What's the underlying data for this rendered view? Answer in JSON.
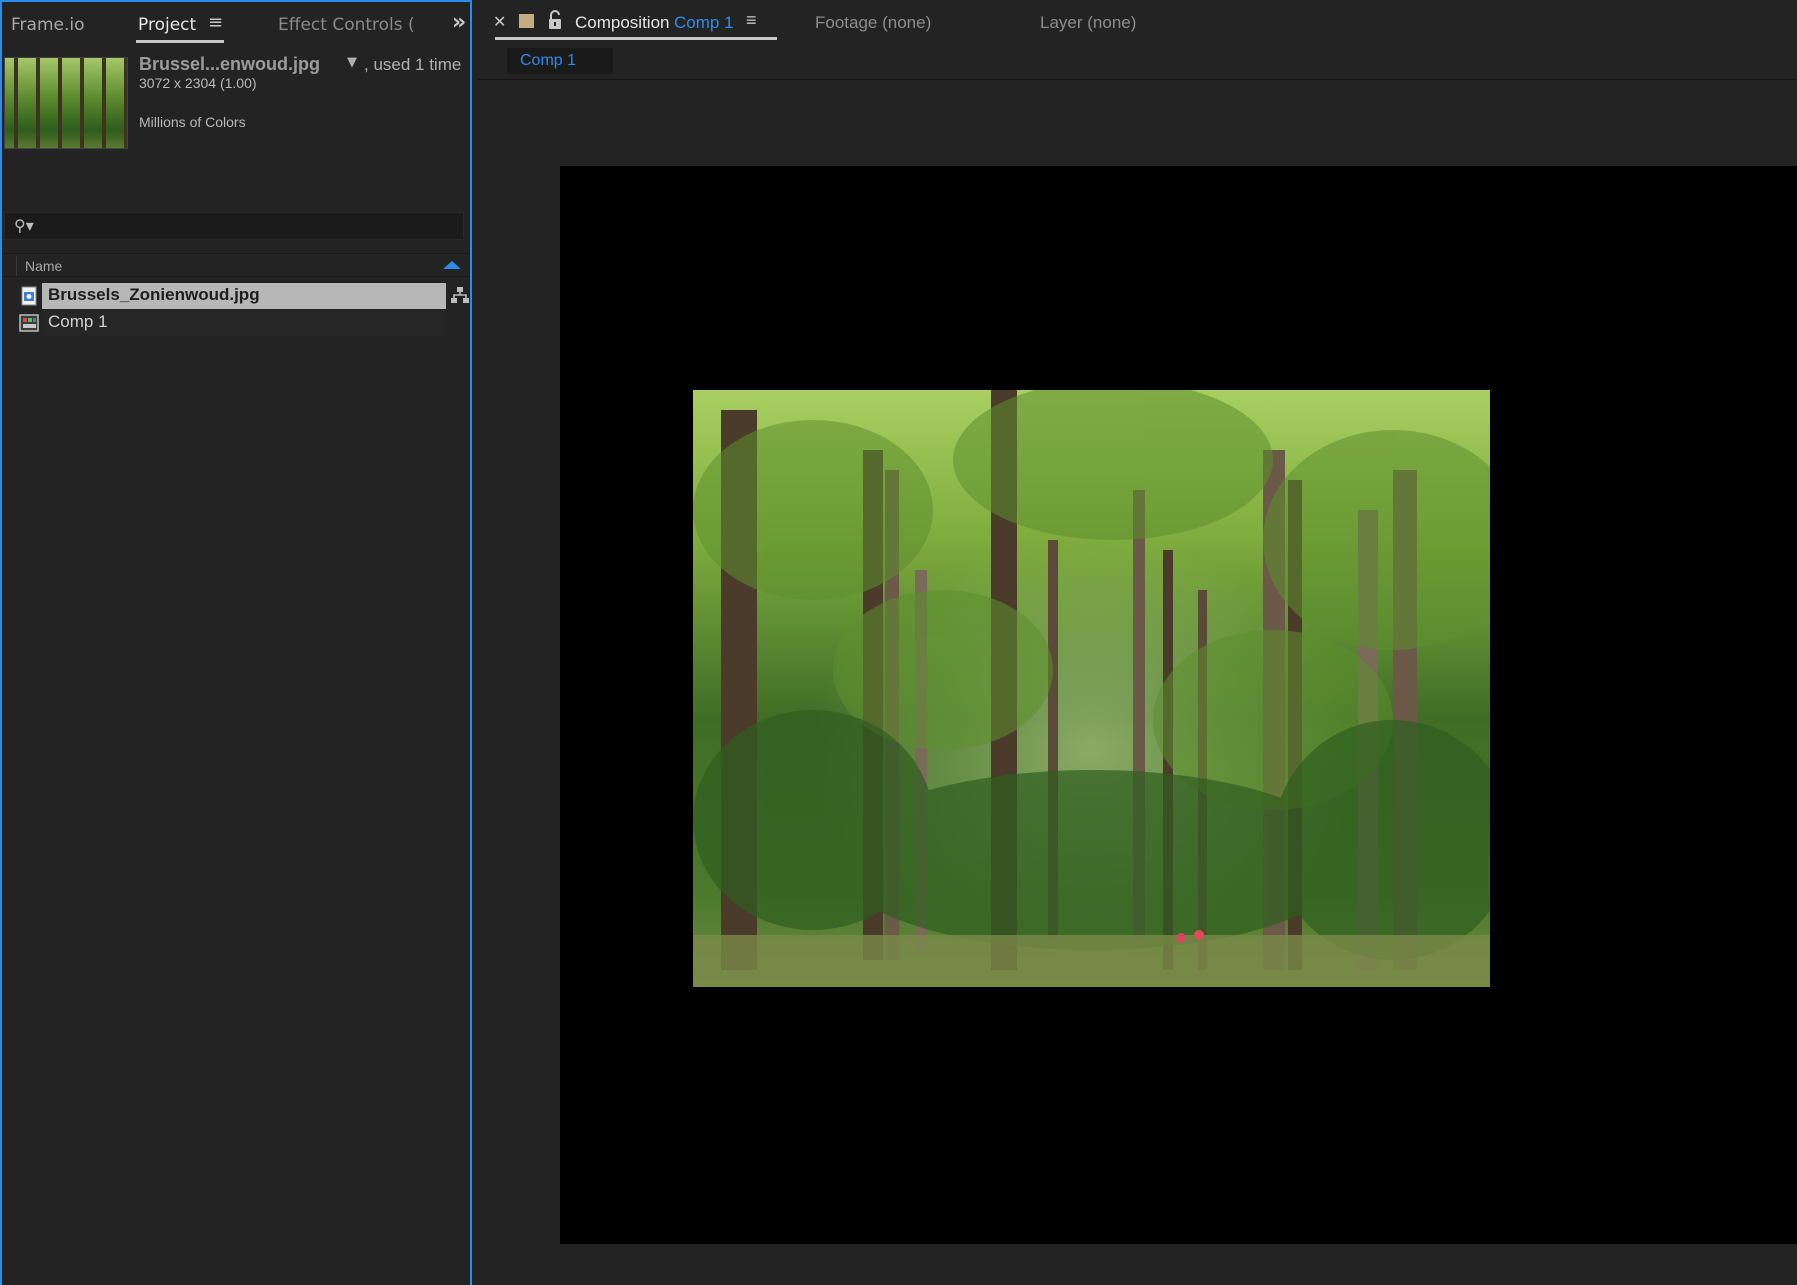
{
  "left_panel": {
    "tabs": [
      "Frame.io",
      "Project",
      "Effect Controls (nc"
    ],
    "active_tab": "Project",
    "asset_preview": {
      "name": "Brussel...enwoud.jpg",
      "usage": ", used 1 time",
      "dimensions": "3072 x 2304 (1.00)",
      "color_depth": "Millions of Colors"
    },
    "search": {
      "placeholder": "",
      "value": ""
    },
    "list_header": {
      "name_column": "Name"
    },
    "items": [
      {
        "label": "Brussels_Zonienwoud.jpg",
        "type": "footage",
        "selected": true,
        "icon": "footage-icon"
      },
      {
        "label": "Comp 1",
        "type": "composition",
        "selected": false,
        "icon": "composition-icon"
      }
    ]
  },
  "right_panel": {
    "composition_tab": {
      "label": "Composition",
      "name": "Comp 1"
    },
    "footage_tab": "Footage  (none)",
    "layer_tab": "Layer  (none)",
    "breadcrumb": "Comp 1",
    "label_color": "#c5ab82"
  },
  "colors": {
    "accent": "#2d8ceb",
    "panel_bg": "#232323",
    "viewport_bg": "#000000"
  }
}
